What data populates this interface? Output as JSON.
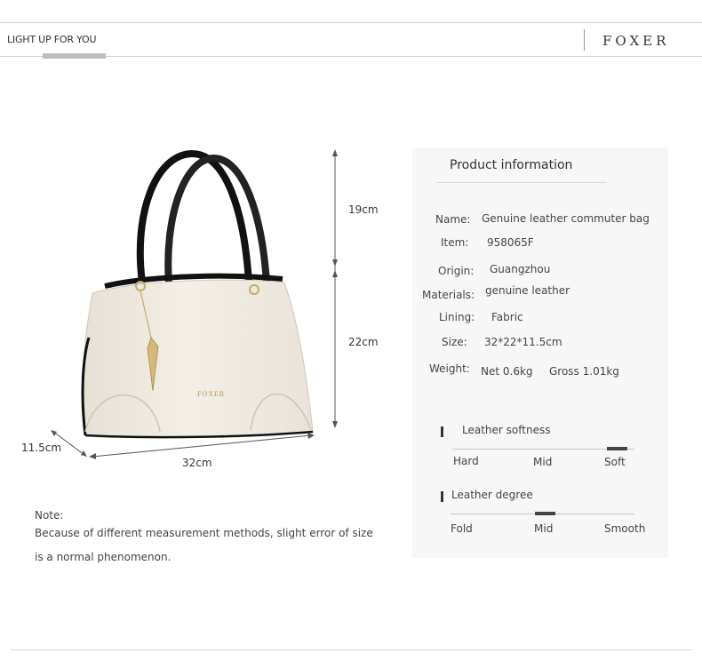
{
  "header": {
    "tagline": "LIGHT UP FOR YOU",
    "brand": "FOXER"
  },
  "product_image": {
    "logo_text": "FOXER",
    "description_colors": {
      "body": "#efe9df",
      "handles": "#111111",
      "trim": "#000000",
      "hardware": "#c9a96a"
    }
  },
  "dimensions": {
    "handle_height": "19cm",
    "bag_height": "22cm",
    "depth": "11.5cm",
    "width": "32cm"
  },
  "note": {
    "label": "Note:",
    "line1": "Because of different measurement methods, slight error of size",
    "line2": "is a normal phenomenon."
  },
  "product_info": {
    "title": "Product information",
    "rows": [
      {
        "label": "Name:",
        "value": "Genuine leather commuter bag"
      },
      {
        "label": "Item:",
        "value": "958065F"
      },
      {
        "label": "Origin:",
        "value": "Guangzhou"
      },
      {
        "label": "Materials:",
        "value": "genuine leather"
      },
      {
        "label": "Lining:",
        "value": "Fabric"
      },
      {
        "label": "Size:",
        "value": "32*22*11.5cm"
      },
      {
        "label": "Weight:",
        "value": "Net 0.6kg",
        "value2": "Gross 1.01kg"
      }
    ]
  },
  "scales": [
    {
      "title": "Leather softness",
      "options": [
        "Hard",
        "Mid",
        "Soft"
      ],
      "selected": "Soft"
    },
    {
      "title": "Leather degree",
      "options": [
        "Fold",
        "Mid",
        "Smooth"
      ],
      "selected": "Mid"
    }
  ],
  "colors": {
    "accent_bar": "#bdbdbd",
    "panel_bg": "#f7f7f7",
    "line": "#cfcfcf"
  }
}
